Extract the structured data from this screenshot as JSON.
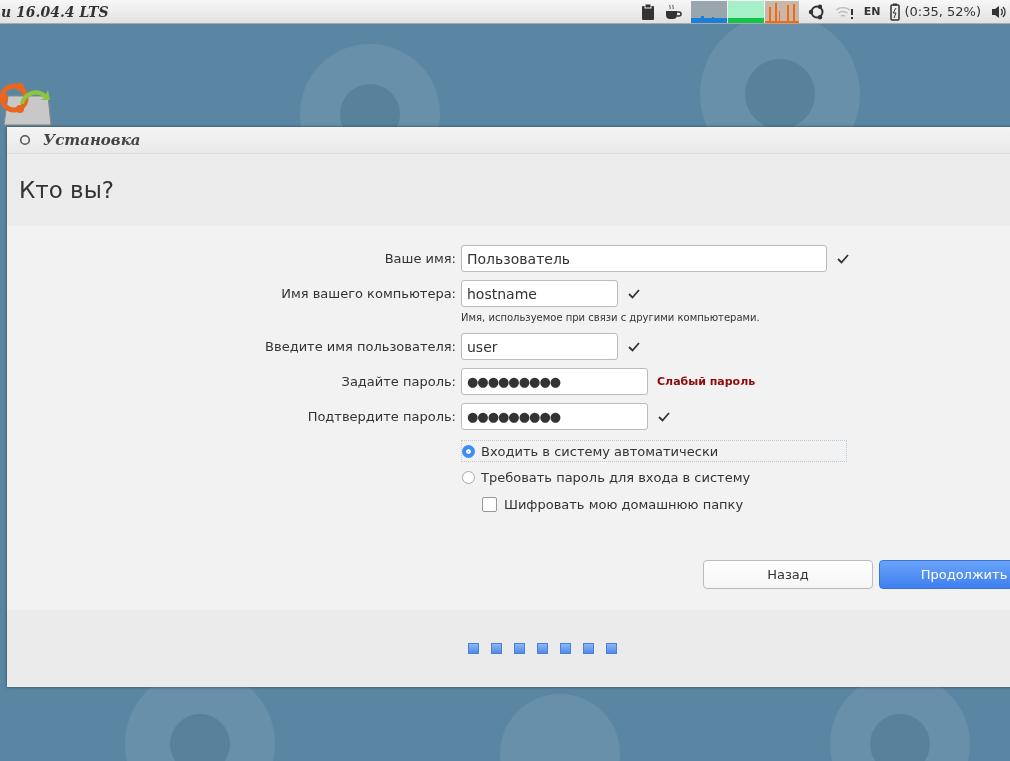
{
  "top_panel": {
    "title": "u 16.04.4 LTS",
    "keyboard_layout": "EN",
    "battery_text": "(0:35, 52%)"
  },
  "window": {
    "title": "Установка",
    "heading": "Кто вы?"
  },
  "fields": [
    {
      "label": "Ваше имя:",
      "value": "Пользователь",
      "kind": "text",
      "valid": true
    },
    {
      "label": "Имя вашего компьютера:",
      "value": "hostname",
      "kind": "text",
      "valid": true,
      "hint": "Имя, используемое при связи с другими компьютерами."
    },
    {
      "label": "Введите имя пользователя:",
      "value": "user",
      "kind": "text",
      "valid": true
    },
    {
      "label": "Задайте пароль:",
      "value": "●●●●●●●●●",
      "kind": "password",
      "valid": false,
      "status_text": "Слабый пароль"
    },
    {
      "label": "Подтвердите пароль:",
      "value": "●●●●●●●●●",
      "kind": "password",
      "valid": true
    }
  ],
  "login_options": [
    {
      "label": "Входить в систему автоматически",
      "selected": true
    },
    {
      "label": "Требовать пароль для входа в систему",
      "selected": false
    }
  ],
  "encrypt_home": {
    "label": "Шифровать мою домашнюю папку",
    "checked": false
  },
  "buttons": {
    "back": "Назад",
    "continue": "Продолжить"
  },
  "steps": [
    {
      "completed": true
    },
    {
      "completed": true
    },
    {
      "completed": true
    },
    {
      "completed": true
    },
    {
      "completed": true
    },
    {
      "completed": true
    },
    {
      "completed": true
    }
  ]
}
